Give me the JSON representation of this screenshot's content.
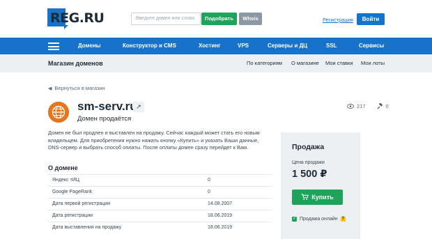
{
  "header": {
    "logo_text": "REG.RU",
    "search_placeholder": "Введите домен или слово",
    "pick_button": "Подобрать",
    "whois_button": "Whois",
    "register_link": "Регистрация",
    "login_button": "Войти"
  },
  "nav": {
    "items": [
      "Домены",
      "Конструктор и CMS",
      "Хостинг",
      "VPS",
      "Серверы и ДЦ",
      "SSL",
      "Сервисы"
    ]
  },
  "subheader": {
    "title": "Магазин доменов",
    "links": [
      "По категориям",
      "О магазине",
      "Мои ставки",
      "Мои лоты"
    ]
  },
  "page": {
    "back_link": "Вернуться в магазин",
    "domain": "sm-serv.ru",
    "status": "Домен продаётся",
    "views": "217",
    "bids": "0",
    "description": "Домен не был продлен и выставлен на продажу. Сейчас каждый может стать его новым владельцем. Для приобретения нужно нажать кнопку «Купить» и указать Ваши данные, DNS-сервер и выбрать способ оплаты. После оплаты домен сразу перейдет к Вам.",
    "about_title": "О домене",
    "about_rows": [
      {
        "key": "Яндекс тИЦ",
        "value": "0"
      },
      {
        "key": "Google PageRank",
        "value": "0"
      },
      {
        "key": "Дата первой регистрации",
        "value": "14.08.2007"
      },
      {
        "key": "Дата регистрации",
        "value": "18.06.2019"
      },
      {
        "key": "Дата выставления на продажу",
        "value": "18.06.2019"
      }
    ]
  },
  "sale": {
    "title": "Продажа",
    "price_label": "Цена продажи",
    "price": "1 500 ₽",
    "buy_button": "Купить",
    "online_label": "Продажа онлайн",
    "help_mark": "?"
  },
  "colors": {
    "brand_blue": "#1773c9",
    "green": "#1fa35b",
    "globe_orange": "#e6761d"
  }
}
